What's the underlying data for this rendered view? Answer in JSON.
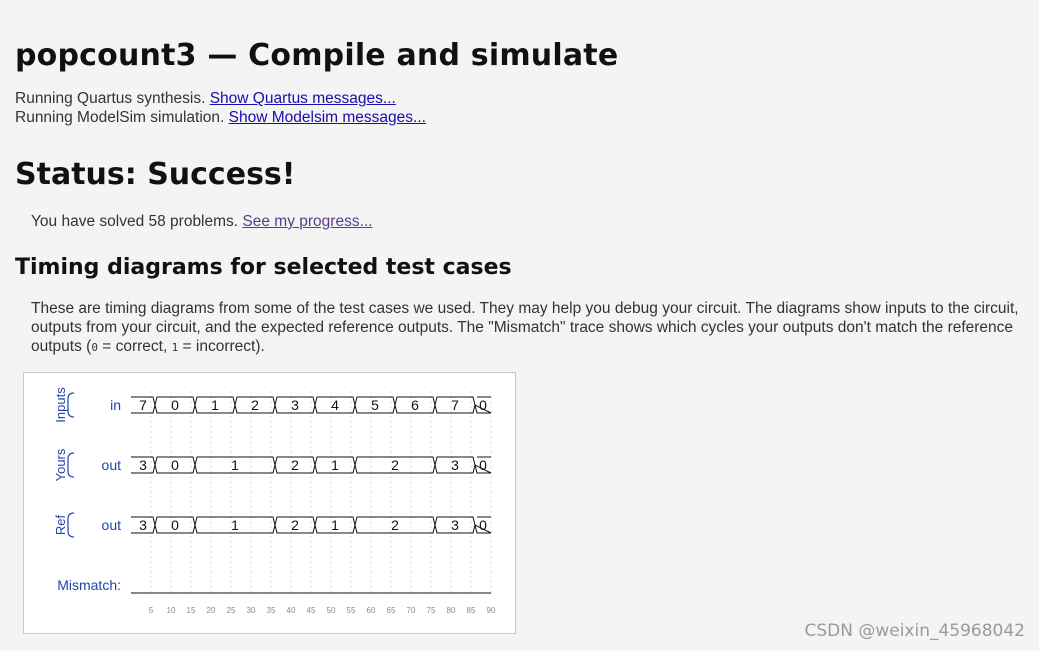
{
  "page": {
    "title": "popcount3 — Compile and simulate",
    "quartus_text": "Running Quartus synthesis.",
    "quartus_link": "Show Quartus messages...",
    "modelsim_text": "Running ModelSim simulation.",
    "modelsim_link": "Show Modelsim messages...",
    "status": "Status: Success!",
    "progress_text": "You have solved 58 problems.",
    "progress_link": "See my progress...",
    "timing_heading": "Timing diagrams for selected test cases",
    "desc_part1": "These are timing diagrams from some of the test cases we used. They may help you debug your circuit. The diagrams show inputs to the circuit, outputs from your circuit, and the expected reference outputs. The \"Mismatch\" trace shows which cycles your outputs don't match the reference outputs (",
    "desc_code0": "0",
    "desc_part2": " = correct, ",
    "desc_code1": "1",
    "desc_part3": " = incorrect).",
    "watermark": "CSDN @weixin_45968042"
  },
  "waveform": {
    "colors": {
      "label": "#2244aa",
      "trace": "#111111",
      "grid": "#d8d8d8",
      "axis_text": "#8a8a8a"
    },
    "groups": [
      {
        "label": "Inputs",
        "signals": [
          {
            "name": "in",
            "segments": [
              {
                "t0": 0,
                "t1": 6,
                "value": "7"
              },
              {
                "t0": 6,
                "t1": 16,
                "value": "0"
              },
              {
                "t0": 16,
                "t1": 26,
                "value": "1"
              },
              {
                "t0": 26,
                "t1": 36,
                "value": "2"
              },
              {
                "t0": 36,
                "t1": 46,
                "value": "3"
              },
              {
                "t0": 46,
                "t1": 56,
                "value": "4"
              },
              {
                "t0": 56,
                "t1": 66,
                "value": "5"
              },
              {
                "t0": 66,
                "t1": 76,
                "value": "6"
              },
              {
                "t0": 76,
                "t1": 86,
                "value": "7"
              },
              {
                "t0": 86,
                "t1": 90,
                "value": "0"
              }
            ]
          }
        ]
      },
      {
        "label": "Yours",
        "signals": [
          {
            "name": "out",
            "segments": [
              {
                "t0": 0,
                "t1": 6,
                "value": "3"
              },
              {
                "t0": 6,
                "t1": 16,
                "value": "0"
              },
              {
                "t0": 16,
                "t1": 36,
                "value": "1"
              },
              {
                "t0": 36,
                "t1": 46,
                "value": "2"
              },
              {
                "t0": 46,
                "t1": 56,
                "value": "1"
              },
              {
                "t0": 56,
                "t1": 76,
                "value": "2"
              },
              {
                "t0": 76,
                "t1": 86,
                "value": "3"
              },
              {
                "t0": 86,
                "t1": 90,
                "value": "0"
              }
            ]
          }
        ]
      },
      {
        "label": "Ref",
        "signals": [
          {
            "name": "out",
            "segments": [
              {
                "t0": 0,
                "t1": 6,
                "value": "3"
              },
              {
                "t0": 6,
                "t1": 16,
                "value": "0"
              },
              {
                "t0": 16,
                "t1": 36,
                "value": "1"
              },
              {
                "t0": 36,
                "t1": 46,
                "value": "2"
              },
              {
                "t0": 46,
                "t1": 56,
                "value": "1"
              },
              {
                "t0": 56,
                "t1": 76,
                "value": "2"
              },
              {
                "t0": 76,
                "t1": 86,
                "value": "3"
              },
              {
                "t0": 86,
                "t1": 90,
                "value": "0"
              }
            ]
          }
        ]
      }
    ],
    "mismatch_label": "Mismatch:",
    "mismatch_value": 0,
    "time_range": [
      0,
      90
    ],
    "ticks": [
      "5",
      "10",
      "15",
      "20",
      "25",
      "30",
      "35",
      "40",
      "45",
      "50",
      "55",
      "60",
      "65",
      "70",
      "75",
      "80",
      "85",
      "90"
    ]
  }
}
